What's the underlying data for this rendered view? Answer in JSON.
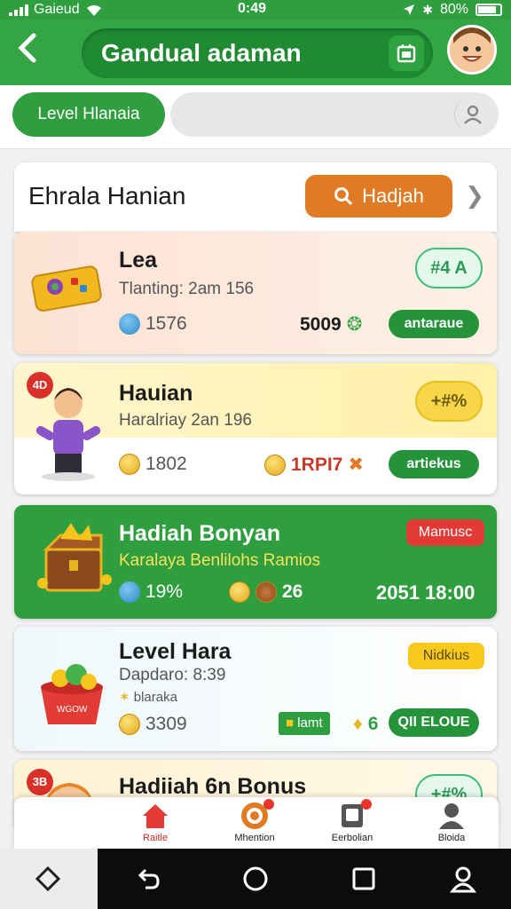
{
  "status": {
    "carrier": "Gaieud",
    "time": "0:49",
    "battery": "80%"
  },
  "header": {
    "back_label": "<",
    "title": "Gandual adaman"
  },
  "search": {
    "level_label": "Level Hlanaia",
    "placeholder": ""
  },
  "panel": {
    "title": "Ehrala Hanian",
    "action_label": "Hadjah"
  },
  "items": [
    {
      "name": "Lea",
      "sub": "Tlanting: 2am 156",
      "stat1": "1576",
      "stat2": "5009",
      "button": "antaraue",
      "badge": "#4 A"
    },
    {
      "name": "Hauian",
      "sub": "Haralriay 2an 196",
      "stat1": "1802",
      "stat2": "1RPI7",
      "button": "artiekus",
      "badge": "+#%",
      "corner": "4D"
    },
    {
      "name": "Hadiah Bonyan",
      "sub": "Karalaya Benlilohs Ramios",
      "stat1": "19%",
      "stat2": "26",
      "stat3": "2051 18:00",
      "badge": "Mamusc"
    },
    {
      "name": "Level Hara",
      "sub": "Dapdaro: 8:39",
      "sub2": "blaraka",
      "stat1": "3309",
      "tag": "lamt",
      "stat2": "6",
      "button": "QII ELOUE",
      "badge": "Nidkius"
    },
    {
      "name": "Hadiiah 6n Bonus",
      "badge": "+#%",
      "corner": "3B"
    }
  ],
  "nav": [
    {
      "label": "Raitle"
    },
    {
      "label": "Mhention"
    },
    {
      "label": "Eerbolian"
    },
    {
      "label": "Bloida"
    }
  ],
  "colors": {
    "green": "#33a544",
    "orange": "#e07a23",
    "red": "#d9302a"
  }
}
